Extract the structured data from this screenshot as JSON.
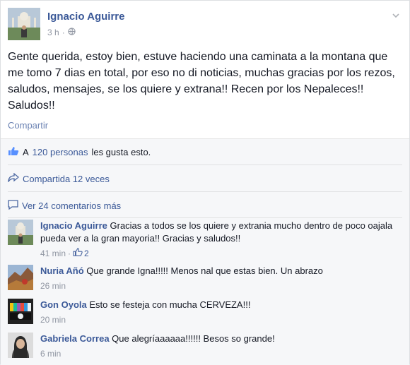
{
  "post": {
    "author": "Ignacio Aguirre",
    "time": "3 h",
    "text": "Gente querida, estoy bien, estuve haciendo una caminata a la montana que me tomo 7 dias en total, por eso no di noticias, muchas gracias por los rezos, saludos, mensajes, se los quiere y extrana!! Recen por los Nepaleces!! Saludos!!",
    "share_label": "Compartir",
    "icons": {
      "audience": "globe-icon",
      "menu": "chevron-down-icon"
    }
  },
  "footer": {
    "likes_prefix": "A",
    "likes_link": "120 personas",
    "likes_suffix": "les gusta esto.",
    "shares": "Compartida 12 veces",
    "view_comments": "Ver 24 comentarios más"
  },
  "comments": [
    {
      "author": "Ignacio Aguirre",
      "text": "Gracias a todos se los quiere y extrania mucho dentro de poco oajala pueda ver a la gran mayoria!! Gracias y saludos!!",
      "time": "41 min",
      "likes": "2"
    },
    {
      "author": "Nuria Añó",
      "text": "Que grande Igna!!!!! Menos nal que estas bien. Un abrazo",
      "time": "26 min"
    },
    {
      "author": "Gon Oyola",
      "text": "Esto se festeja con mucha CERVEZA!!!",
      "time": "20 min"
    },
    {
      "author": "Gabriela Correa",
      "text": "Que alegríaaaaaa!!!!!! Besos so grande!",
      "time": "6 min"
    }
  ],
  "colors": {
    "link": "#3b5998",
    "muted": "#9197a3",
    "footer_bg": "#f6f7f9"
  }
}
